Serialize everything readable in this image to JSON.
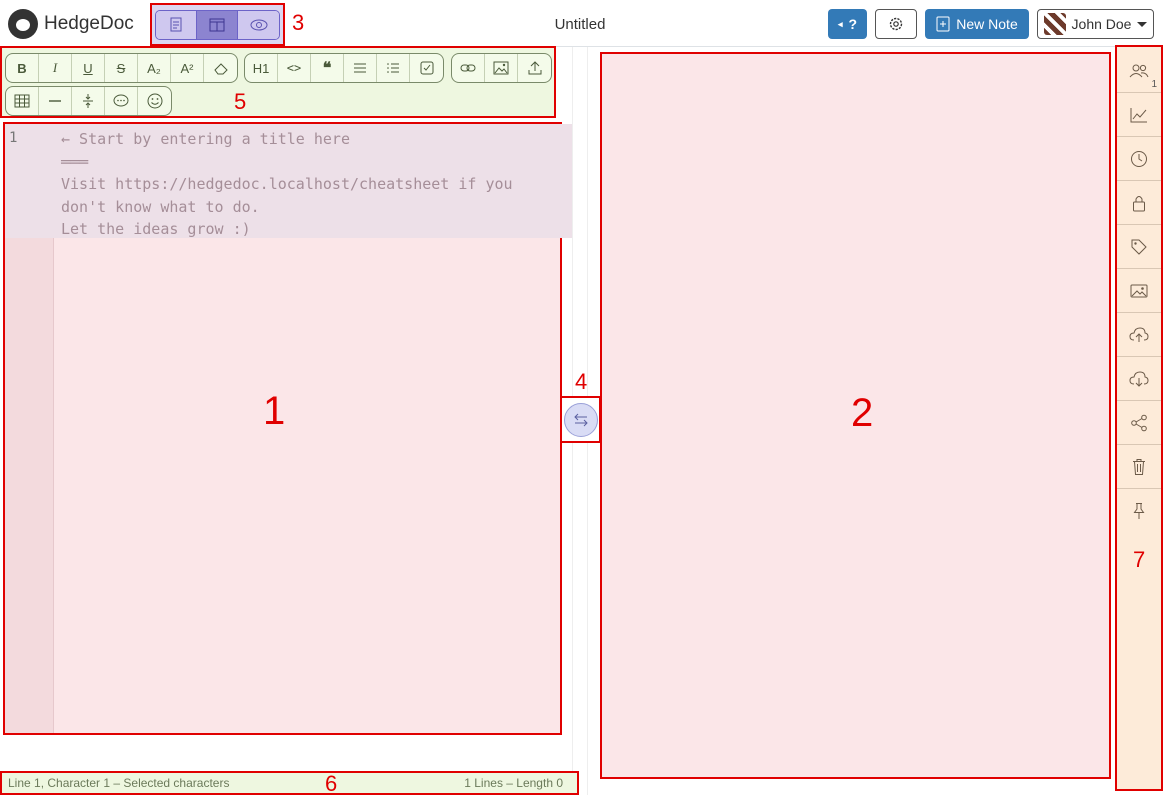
{
  "app": {
    "name": "HedgeDoc"
  },
  "header": {
    "title": "Untitled",
    "help_label": "?",
    "new_note_label": "New Note",
    "user_name": "John Doe"
  },
  "view_modes": [
    {
      "name": "editor-only",
      "icon": "document-icon",
      "active": false
    },
    {
      "name": "split",
      "icon": "split-view-icon",
      "active": true
    },
    {
      "name": "preview-only",
      "icon": "eye-icon",
      "active": false
    }
  ],
  "toolbar": {
    "bold": "B",
    "italic": "I",
    "underline": "U",
    "strike": "S",
    "subscript": "A₂",
    "superscript": "A²",
    "heading": "H1",
    "code": "<>",
    "quote": "❝"
  },
  "editor": {
    "line_number": "1",
    "placeholder": "← Start by entering a title here\n═══\nVisit https://hedgedoc.localhost/cheatsheet if you\ndon't know what to do.\nLet the ideas grow :)"
  },
  "status": {
    "left": "Line 1, Character 1 – Selected characters",
    "right": "1 Lines – Length 0"
  },
  "sidebar": {
    "online_count": "1"
  },
  "annotations": {
    "n1": "1",
    "n2": "2",
    "n3": "3",
    "n4": "4",
    "n5": "5",
    "n6": "6",
    "n7": "7"
  },
  "colors": {
    "accent": "#337ab7",
    "annotation": "#e00000"
  }
}
